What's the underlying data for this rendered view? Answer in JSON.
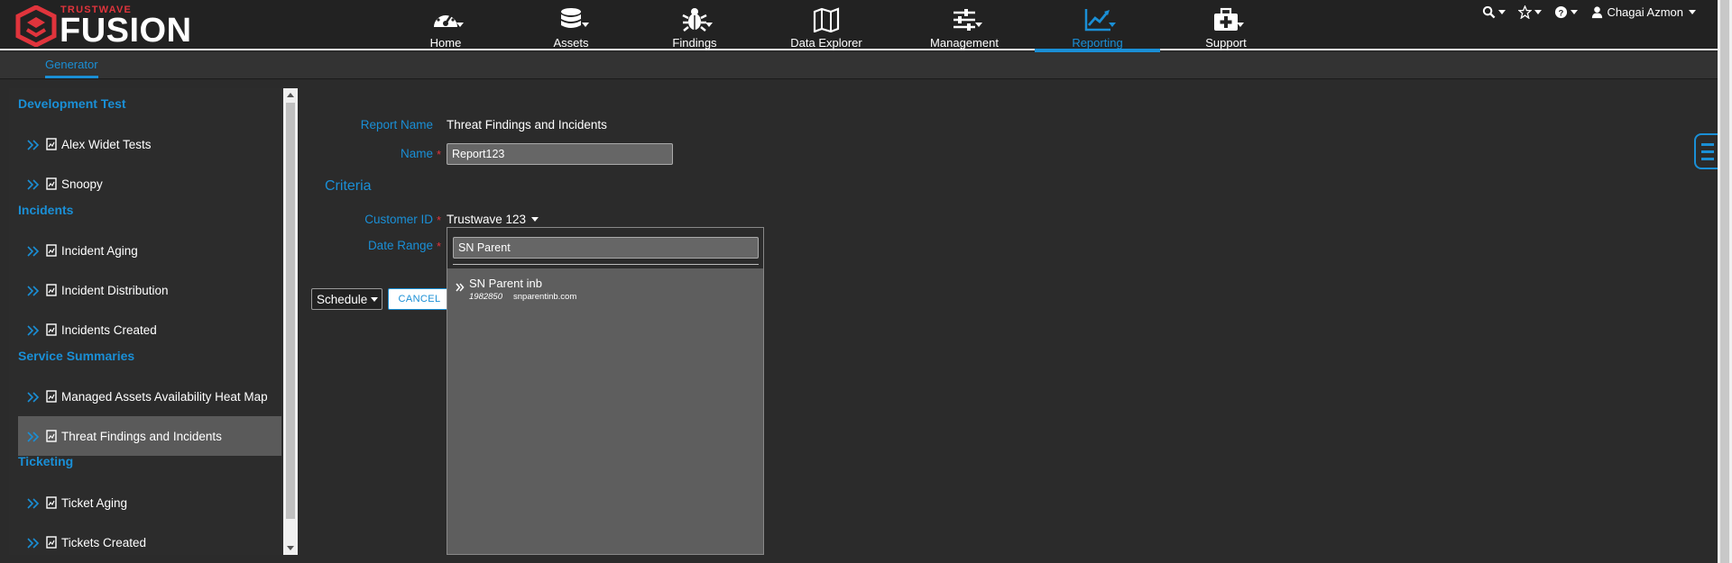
{
  "brand": {
    "small": "TRUSTWAVE",
    "big": "FUSION",
    "color": "#e0343c"
  },
  "nav": {
    "items": [
      {
        "label": "Home",
        "icon": "dashboard-icon"
      },
      {
        "label": "Assets",
        "icon": "database-icon"
      },
      {
        "label": "Findings",
        "icon": "bug-icon"
      },
      {
        "label": "Data Explorer",
        "icon": "map-icon"
      },
      {
        "label": "Management",
        "icon": "sliders-icon"
      },
      {
        "label": "Reporting",
        "icon": "chart-line-icon",
        "active": true
      },
      {
        "label": "Support",
        "icon": "first-aid-kit-icon"
      }
    ]
  },
  "user": {
    "name": "Chagai Azmon"
  },
  "subnav": {
    "active_tab": "Generator"
  },
  "accent_color": "#1a8fd6",
  "sidebar": {
    "groups": [
      {
        "title": "Development Test",
        "items": [
          "Alex Widet Tests",
          "Snoopy"
        ]
      },
      {
        "title": "Incidents",
        "items": [
          "Incident Aging",
          "Incident Distribution",
          "Incidents Created"
        ]
      },
      {
        "title": "Service Summaries",
        "items": [
          "Managed Assets Availability Heat Map",
          "Threat Findings and Incidents"
        ]
      },
      {
        "title": "Ticketing",
        "items": [
          "Ticket Aging",
          "Tickets Created"
        ]
      }
    ],
    "selected": "Threat Findings and Incidents"
  },
  "form": {
    "report_name_label": "Report Name",
    "report_name_value": "Threat Findings and Incidents",
    "name_label": "Name",
    "name_value": "Report123",
    "criteria_title": "Criteria",
    "customer_id_label": "Customer ID",
    "customer_id_value": "Trustwave 123",
    "date_range_label": "Date Range",
    "required_mark": "*",
    "schedule_label": "Schedule",
    "cancel_label": "CANCEL"
  },
  "dropdown": {
    "search_value": "SN Parent",
    "options": [
      {
        "name": "SN Parent inb",
        "id": "1982850",
        "domain": "snparentinb.com"
      }
    ]
  }
}
